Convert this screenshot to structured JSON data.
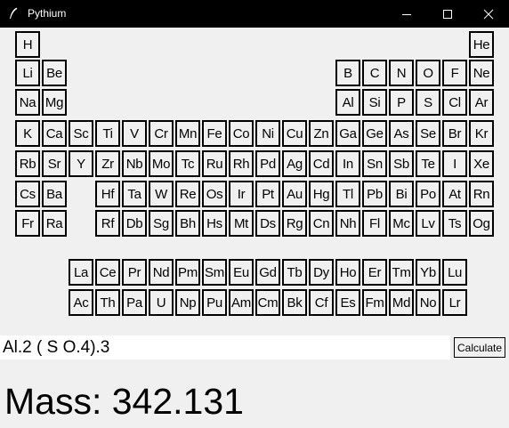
{
  "window": {
    "title": "Pythium",
    "minimize_icon": "minimize-icon",
    "maximize_icon": "maximize-icon",
    "close_icon": "close-icon",
    "app_icon": "feather-icon"
  },
  "periodic_table": {
    "rows": [
      [
        "H",
        null,
        null,
        null,
        null,
        null,
        null,
        null,
        null,
        null,
        null,
        null,
        null,
        null,
        null,
        null,
        null,
        "He"
      ],
      [
        "Li",
        "Be",
        null,
        null,
        null,
        null,
        null,
        null,
        null,
        null,
        null,
        null,
        "B",
        "C",
        "N",
        "O",
        "F",
        "Ne"
      ],
      [
        "Na",
        "Mg",
        null,
        null,
        null,
        null,
        null,
        null,
        null,
        null,
        null,
        null,
        "Al",
        "Si",
        "P",
        "S",
        "Cl",
        "Ar"
      ],
      [
        "K",
        "Ca",
        "Sc",
        "Ti",
        "V",
        "Cr",
        "Mn",
        "Fe",
        "Co",
        "Ni",
        "Cu",
        "Zn",
        "Ga",
        "Ge",
        "As",
        "Se",
        "Br",
        "Kr"
      ],
      [
        "Rb",
        "Sr",
        "Y",
        "Zr",
        "Nb",
        "Mo",
        "Tc",
        "Ru",
        "Rh",
        "Pd",
        "Ag",
        "Cd",
        "In",
        "Sn",
        "Sb",
        "Te",
        "I",
        "Xe"
      ],
      [
        "Cs",
        "Ba",
        null,
        "Hf",
        "Ta",
        "W",
        "Re",
        "Os",
        "Ir",
        "Pt",
        "Au",
        "Hg",
        "Tl",
        "Pb",
        "Bi",
        "Po",
        "At",
        "Rn"
      ],
      [
        "Fr",
        "Ra",
        null,
        "Rf",
        "Db",
        "Sg",
        "Bh",
        "Hs",
        "Mt",
        "Ds",
        "Rg",
        "Cn",
        "Nh",
        "Fl",
        "Mc",
        "Lv",
        "Ts",
        "Og"
      ]
    ],
    "lanthanides": [
      "La",
      "Ce",
      "Pr",
      "Nd",
      "Pm",
      "Sm",
      "Eu",
      "Gd",
      "Tb",
      "Dy",
      "Ho",
      "Er",
      "Tm",
      "Yb",
      "Lu"
    ],
    "actinides": [
      "Ac",
      "Th",
      "Pa",
      "U",
      "Np",
      "Pu",
      "Am",
      "Cm",
      "Bk",
      "Cf",
      "Es",
      "Fm",
      "Md",
      "No",
      "Lr"
    ]
  },
  "formula": {
    "value": "Al.2 ( S O.4).3"
  },
  "calculate_label": "Calculate",
  "result": {
    "mass_text": "Mass: 342.131"
  },
  "colors": {
    "titlebar": "#000000",
    "background": "#f0f0f0",
    "input_background": "#ffffff",
    "border": "#000000"
  }
}
